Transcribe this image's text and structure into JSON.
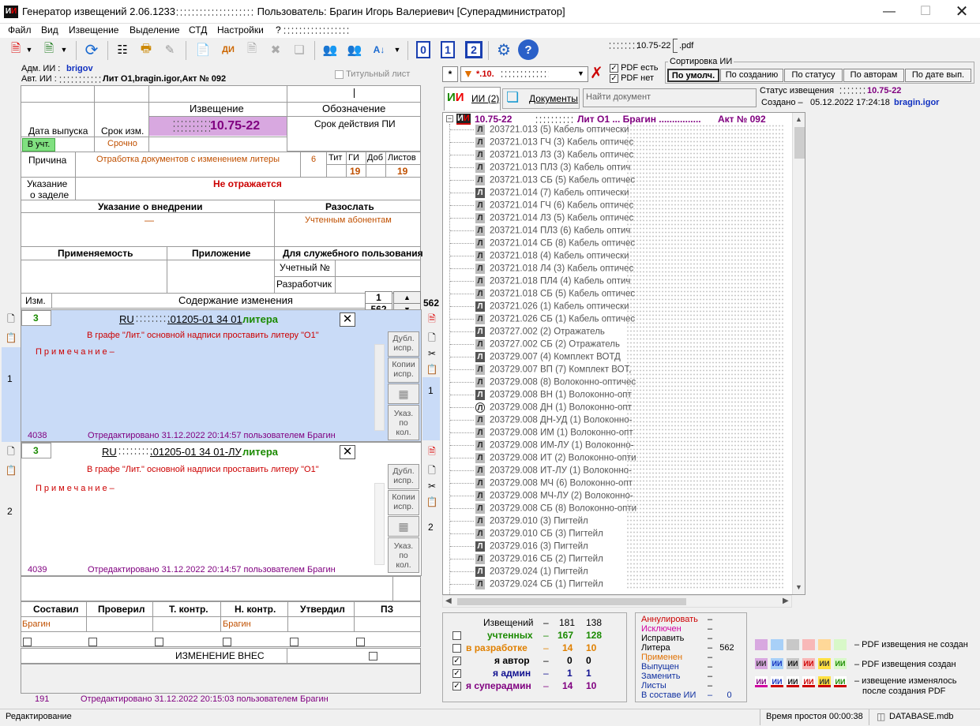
{
  "window": {
    "title_app": "Генератор извещений 2.06.1233",
    "title_user": "Пользователь: Брагин Игорь Валериевич [Суперадминистратор]"
  },
  "menu": [
    "Файл",
    "Вид",
    "Извещение",
    "Выделение",
    "СТД",
    "Настройки",
    "?"
  ],
  "toolbar": {
    "num0": "0",
    "num1": "1",
    "num2": "2",
    "pdf_name_suffix": "10.75-22",
    "pdf_ext": ".pdf"
  },
  "header": {
    "adm_label": "Адм. ИИ :",
    "adm_value": "brigov",
    "avt_label": "Авт. ИИ :",
    "avt_value": "Лит О1,bragin.igor,Акт № 092",
    "titul_label": "Титульный лист"
  },
  "form": {
    "izv_label": "Извещение",
    "oboz_label": "Обозначение",
    "date_label": "Дата выпуска",
    "srok_label": "Срок изм.",
    "izv_number": "10.75-22",
    "srok_pi_label": "Срок действия ПИ",
    "v_ucht": "В учт.",
    "srochno": "Срочно",
    "prichina_label": "Причина",
    "prichina_value": "Отработка документов с изменением литеры",
    "prichina_code": "6",
    "tit_label": "Тит",
    "gi_label": "ГИ",
    "dob_label": "Доб",
    "listov_label": "Листов",
    "gi_value": "19",
    "listov_value": "19",
    "ukaz_label1": "Указание",
    "ukaz_label2": "о заделе",
    "ukaz_value": "Не отражается",
    "vnedr_label": "Указание о внедрении",
    "razoslat_label": "Разослать",
    "vnedr_value": "—",
    "razoslat_value": "Учтенным абонентам",
    "prim_label": "Применяемость",
    "pril_label": "Приложение",
    "sluzh_label": "Для служебного пользования",
    "uchet_label": "Учетный №",
    "razrab_label": "Разработчик",
    "izm_label": "Изм.",
    "sod_label": "Содержание изменения",
    "page_cur": "1",
    "page_total": "562",
    "page_total_side": "562"
  },
  "changes": [
    {
      "num": "3",
      "ru": "RU",
      "code": ".01205-01 34 01",
      "word": "литера",
      "text": "В графе \"Лит.\" основной надписи проставить литеру \"О1\"",
      "note": "Примечание–",
      "id": "4038",
      "edited": "Отредактировано  31.12.2022 20:14:57  пользователем  Брагин",
      "side": "1"
    },
    {
      "num": "3",
      "ru": "RU",
      "code": ".01205-01 34 01-ЛУ",
      "word": "литера",
      "text": "В графе \"Лит.\" основной надписи проставить литеру \"О1\"",
      "note": "Примечание–",
      "id": "4039",
      "edited": "Отредактировано  31.12.2022 20:14:57  пользователем  Брагин",
      "side": "2"
    }
  ],
  "change_buttons": {
    "dubl": "Дубл. испр.",
    "kopii": "Копии испр.",
    "ukaz1": "Указ.",
    "ukaz2": "по",
    "ukaz3": "кол."
  },
  "sign": {
    "cols": [
      "Составил",
      "Проверил",
      "Т. контр.",
      "Н. контр.",
      "Утвердил",
      "ПЗ"
    ],
    "sostavil": "Брагин",
    "nkontr": "Брагин",
    "izm_vnes": "ИЗМЕНЕНИЕ ВНЕС",
    "footer_id": "191",
    "footer_edit": "Отредактировано  31.12.2022 20:15:03  пользователем  Брагин"
  },
  "right": {
    "filter": "*.10.",
    "pdf_yes": "PDF есть",
    "pdf_no": "PDF нет",
    "sort_title": "Сортировка ИИ",
    "sort_btns": [
      "По умолч.",
      "По созданию",
      "По статусу",
      "По авторам",
      "По дате вып."
    ],
    "tab_ii": "ИИ (2)",
    "tab_docs": "Документы",
    "search_placeholder": "Найти документ",
    "status_label": "Статус извещения",
    "status_value": "10.75-22",
    "created_label": "Создано –",
    "created_value": "05.12.2022 17:24:18",
    "created_user": "bragin.igor"
  },
  "tree": {
    "root": "10.75-22",
    "root_lit": "Лит О1 ...  Брагин ................",
    "root_act": "Акт № 092",
    "items": [
      {
        "t": "203721.013 (5) Кабель оптически",
        "d": 0
      },
      {
        "t": "203721.013 ГЧ (3) Кабель оптичес",
        "d": 0
      },
      {
        "t": "203721.013 Л3 (3) Кабель оптичес",
        "d": 0
      },
      {
        "t": "203721.013 ПЛ3 (3) Кабель оптич",
        "d": 0
      },
      {
        "t": "203721.013 СБ (5) Кабель оптичес",
        "d": 0
      },
      {
        "t": "203721.014 (7) Кабель оптически",
        "d": 1
      },
      {
        "t": "203721.014 ГЧ (6) Кабель оптичес",
        "d": 0
      },
      {
        "t": "203721.014 Л3 (5) Кабель оптичес",
        "d": 0
      },
      {
        "t": "203721.014 ПЛ3 (6) Кабель оптич",
        "d": 0
      },
      {
        "t": "203721.014 СБ (8) Кабель оптичес",
        "d": 0
      },
      {
        "t": "203721.018 (4) Кабель оптически",
        "d": 0
      },
      {
        "t": "203721.018 Л4 (3) Кабель оптичес",
        "d": 0
      },
      {
        "t": "203721.018 ПЛ4 (4) Кабель оптич",
        "d": 0
      },
      {
        "t": "203721.018 СБ (5) Кабель оптичес",
        "d": 0
      },
      {
        "t": "203721.026 (1) Кабель оптически",
        "d": 1
      },
      {
        "t": "203721.026 СБ (1) Кабель оптичес",
        "d": 0
      },
      {
        "t": "203727.002 (2) Отражатель",
        "d": 1
      },
      {
        "t": "203727.002 СБ (2) Отражатель",
        "d": 0
      },
      {
        "t": "203729.007 (4) Комплект ВОТД",
        "d": 1
      },
      {
        "t": "203729.007 ВП (7) Комплект ВОТ,",
        "d": 0
      },
      {
        "t": "203729.008 (8) Волоконно-оптичес",
        "d": 0
      },
      {
        "t": "203729.008 ВН (1) Волоконно-опт",
        "d": 1
      },
      {
        "t": "203729.008 ДН (1) Волоконно-опт",
        "d": 2
      },
      {
        "t": "203729.008 ДН-УД (1) Волоконно-",
        "d": 0
      },
      {
        "t": "203729.008 ИМ (1) Волоконно-опт",
        "d": 0
      },
      {
        "t": "203729.008 ИМ-ЛУ (1) Волоконно-",
        "d": 0
      },
      {
        "t": "203729.008 ИТ (2) Волоконно-опти",
        "d": 0
      },
      {
        "t": "203729.008 ИТ-ЛУ (1) Волоконно-",
        "d": 0
      },
      {
        "t": "203729.008 МЧ (6) Волоконно-опт",
        "d": 0
      },
      {
        "t": "203729.008 МЧ-ЛУ (2) Волоконно-",
        "d": 0
      },
      {
        "t": "203729.008 СБ (8) Волоконно-опти",
        "d": 0
      },
      {
        "t": "203729.010 (3) Пигтейл",
        "d": 0
      },
      {
        "t": "203729.010 СБ (3) Пигтейл",
        "d": 0
      },
      {
        "t": "203729.016 (3) Пигтейл",
        "d": 1
      },
      {
        "t": "203729.016 СБ (2) Пигтейл",
        "d": 0
      },
      {
        "t": "203729.024 (1) Пигтейл",
        "d": 1
      },
      {
        "t": "203729.024 СБ (1) Пигтейл",
        "d": 0
      }
    ]
  },
  "stats": {
    "rows": [
      {
        "label": "Извещений",
        "dash": "–",
        "a": "181",
        "b": "138"
      },
      {
        "label": "учтенных",
        "dash": "–",
        "a": "167",
        "b": "128"
      },
      {
        "label": "в разработке",
        "dash": "–",
        "a": "14",
        "b": "10"
      },
      {
        "label": "я автор",
        "dash": "–",
        "a": "0",
        "b": "0"
      },
      {
        "label": "я админ",
        "dash": "–",
        "a": "1",
        "b": "1"
      },
      {
        "label": "я суперадмин",
        "dash": "–",
        "a": "14",
        "b": "10"
      }
    ],
    "flags": [
      {
        "label": "Аннулировать",
        "v": "–"
      },
      {
        "label": "Исключен",
        "v": "–"
      },
      {
        "label": "Исправить",
        "v": "–"
      },
      {
        "label": "Литера",
        "v": "–   562"
      },
      {
        "label": "Применен",
        "v": "–"
      },
      {
        "label": "Выпущен",
        "v": "–"
      },
      {
        "label": "Заменить",
        "v": "–"
      },
      {
        "label": "Листы",
        "v": "–"
      },
      {
        "label": "В составе ИИ",
        "v": "–      0"
      }
    ]
  },
  "legend": {
    "no_pdf": "– PDF извещения не создан",
    "pdf": "– PDF извещения создан",
    "changed1": "– извещение изменялось",
    "changed2": "после создания PDF"
  },
  "statusbar": {
    "left": "Редактирование",
    "idle": "Время простоя 00:00:38",
    "db": "DATABASE.mdb"
  }
}
